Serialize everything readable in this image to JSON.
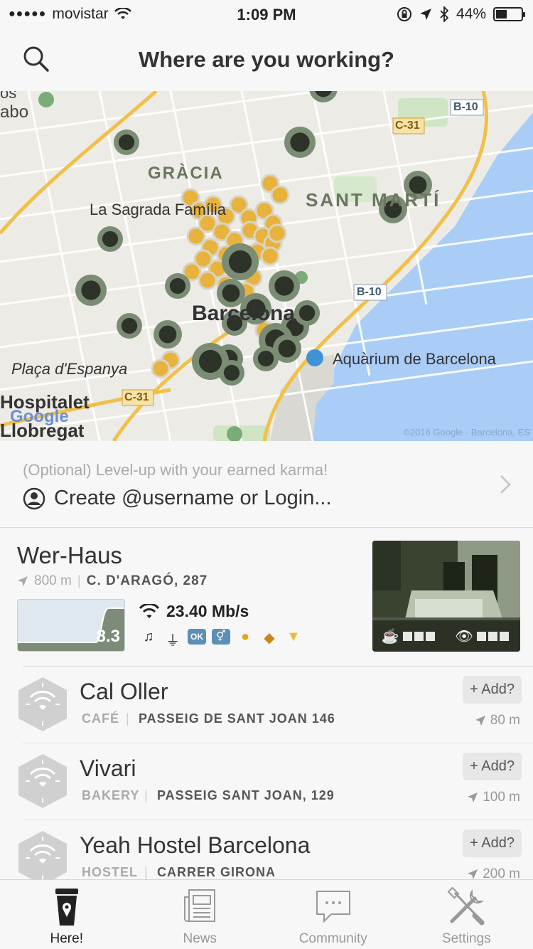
{
  "status": {
    "carrier": "movistar",
    "time": "1:09 PM",
    "battery": "44%",
    "battery_level": 0.44
  },
  "nav": {
    "title": "Where are you working?"
  },
  "map": {
    "labels": {
      "gracia": "GRÀCIA",
      "sant_marti": "SANT MARTÍ",
      "sagrada": "La Sagrada Família",
      "barcelona": "Barcelona",
      "aquarium": "Aquàrium de Barcelona",
      "placa": "Plaça d'Espanya",
      "hospitalet": "Hospitalet",
      "llobregat": "Llobregat",
      "google": "Google",
      "road_b10_top": "B-10",
      "road_b10_mid": "B-10",
      "road_c31_top": "C-31",
      "road_c31_bottom": "C-31",
      "partial_top_left_1": "os",
      "partial_top_left_2": "abo",
      "copyright": "©2016 Google · Barcelona, ES"
    }
  },
  "login": {
    "hint": "(Optional) Level-up with your earned karma!",
    "cta": "Create @username or Login..."
  },
  "featured": {
    "name": "Wer-Haus",
    "distance": "800 m",
    "separator": "|",
    "address": "C. D'ARAGÓ, 287",
    "chart_value": "8.3",
    "wifi_speed": "23.40 Mb/s",
    "ok_badge": "OK",
    "amenity_icons": [
      "music-icon",
      "plug-icon",
      "ok-icon",
      "restroom-icon",
      "food-icon",
      "snack-icon",
      "drink-icon"
    ]
  },
  "venues": [
    {
      "name": "Cal Oller",
      "category": "CAFÉ",
      "address": "PASSEIG DE SANT JOAN 146",
      "add": "+ Add?",
      "distance": "80 m"
    },
    {
      "name": "Vivari",
      "category": "BAKERY",
      "address": "PASSEIG SANT JOAN, 129",
      "add": "+ Add?",
      "distance": "100 m"
    },
    {
      "name": "Yeah Hostel Barcelona",
      "category": "HOSTEL",
      "address": "CARRER GIRONA",
      "add": "+ Add?",
      "distance": "200 m"
    }
  ],
  "tabs": [
    {
      "label": "Here!",
      "active": true
    },
    {
      "label": "News",
      "active": false
    },
    {
      "label": "Community",
      "active": false
    },
    {
      "label": "Settings",
      "active": false
    }
  ],
  "colors": {
    "marker_green": "#7b8c74",
    "marker_dark": "#2e3329",
    "marker_yellow": "#e7b33d",
    "water": "#a9cdf7",
    "road": "#f2c049"
  }
}
